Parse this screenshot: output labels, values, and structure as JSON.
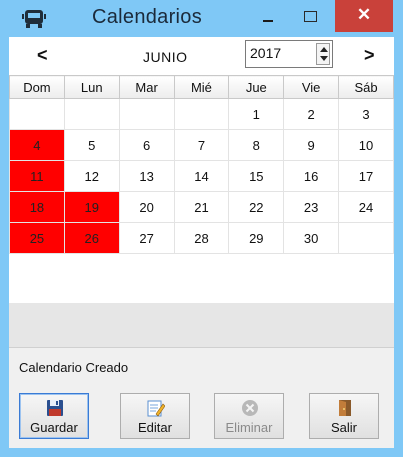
{
  "window": {
    "title": "Calendarios",
    "close_label": "✕"
  },
  "nav": {
    "prev_label": "<",
    "next_label": ">",
    "month": "JUNIO",
    "year": "2017"
  },
  "calendar": {
    "headers": [
      "Dom",
      "Lun",
      "Mar",
      "Mié",
      "Jue",
      "Vie",
      "Sáb"
    ],
    "weeks": [
      [
        {
          "d": ""
        },
        {
          "d": ""
        },
        {
          "d": ""
        },
        {
          "d": ""
        },
        {
          "d": "1"
        },
        {
          "d": "2"
        },
        {
          "d": "3"
        }
      ],
      [
        {
          "d": "4",
          "r": true
        },
        {
          "d": "5"
        },
        {
          "d": "6"
        },
        {
          "d": "7"
        },
        {
          "d": "8"
        },
        {
          "d": "9"
        },
        {
          "d": "10"
        }
      ],
      [
        {
          "d": "11",
          "r": true
        },
        {
          "d": "12"
        },
        {
          "d": "13"
        },
        {
          "d": "14"
        },
        {
          "d": "15"
        },
        {
          "d": "16"
        },
        {
          "d": "17"
        }
      ],
      [
        {
          "d": "18",
          "r": true
        },
        {
          "d": "19",
          "r": true
        },
        {
          "d": "20"
        },
        {
          "d": "21"
        },
        {
          "d": "22"
        },
        {
          "d": "23"
        },
        {
          "d": "24"
        }
      ],
      [
        {
          "d": "25",
          "r": true
        },
        {
          "d": "26",
          "r": true
        },
        {
          "d": "27"
        },
        {
          "d": "28"
        },
        {
          "d": "29"
        },
        {
          "d": "30"
        },
        {
          "d": ""
        }
      ]
    ],
    "highlight_color": "#ff0000"
  },
  "status_text": "Calendario Creado",
  "buttons": {
    "save": "Guardar",
    "edit": "Editar",
    "delete": "Eliminar",
    "exit": "Salir"
  },
  "icons": {
    "app": "bus-icon",
    "save": "floppy-disk-icon",
    "edit": "edit-document-icon",
    "delete": "delete-circle-icon",
    "exit": "door-exit-icon"
  }
}
